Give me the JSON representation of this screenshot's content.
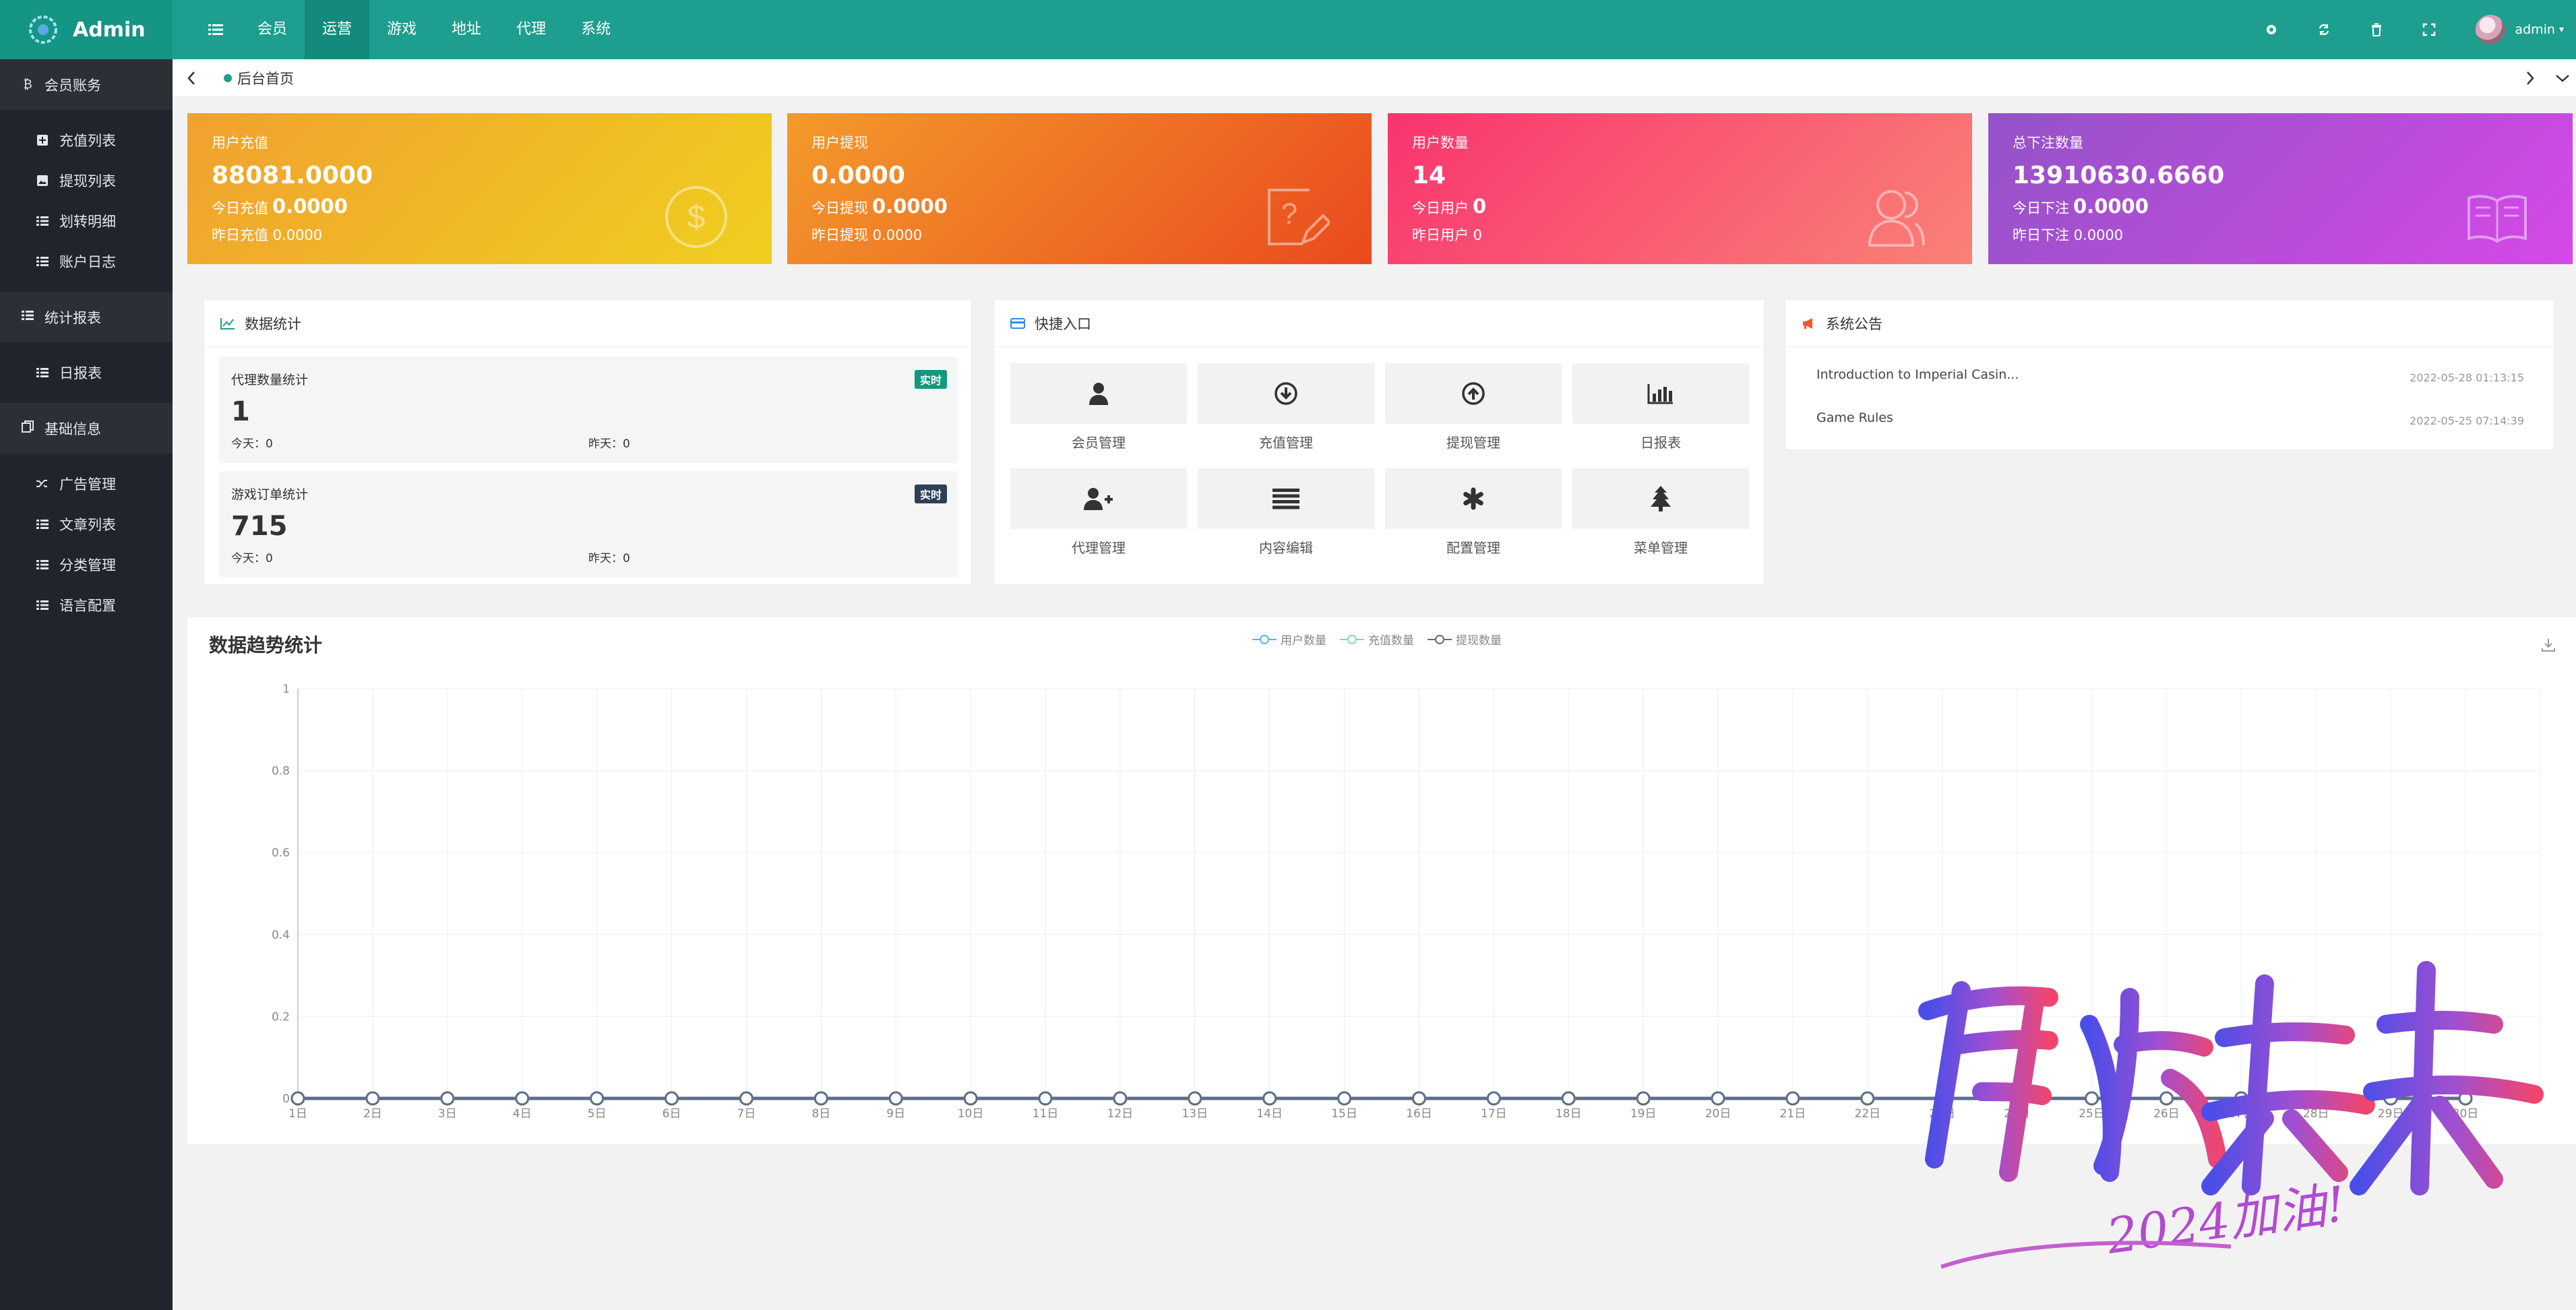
{
  "app": {
    "title": "Admin"
  },
  "topnav": [
    "会员",
    "运营",
    "游戏",
    "地址",
    "代理",
    "系统"
  ],
  "topnav_active": 1,
  "user": {
    "name": "admin"
  },
  "sidebar": {
    "groups": [
      {
        "label": "会员账务",
        "items": [
          "充值列表",
          "提现列表",
          "划转明细",
          "账户日志"
        ]
      },
      {
        "label": "统计报表",
        "items": [
          "日报表"
        ]
      },
      {
        "label": "基础信息",
        "items": [
          "广告管理",
          "文章列表",
          "分类管理",
          "语言配置"
        ]
      }
    ]
  },
  "breadcrumb": "后台首页",
  "stats": [
    {
      "title": "用户充值",
      "value": "88081.0000",
      "today_label": "今日充值",
      "today_value": "0.0000",
      "yesterday": "昨日充值 0.0000",
      "icon": "dollar-circle-icon"
    },
    {
      "title": "用户提现",
      "value": "0.0000",
      "today_label": "今日提现",
      "today_value": "0.0000",
      "yesterday": "昨日提现 0.0000",
      "icon": "question-edit-icon"
    },
    {
      "title": "用户数量",
      "value": "14",
      "today_label": "今日用户",
      "today_value": "0",
      "yesterday": "昨日用户 0",
      "icon": "users-icon"
    },
    {
      "title": "总下注数量",
      "value": "13910630.6660",
      "today_label": "今日下注",
      "today_value": "0.0000",
      "yesterday": "昨日下注 0.0000",
      "icon": "book-icon"
    }
  ],
  "data_stats": {
    "title": "数据统计",
    "cards": [
      {
        "title": "代理数量统计",
        "badge": "实时",
        "badge_color": "#15977f",
        "value": "1",
        "today": "今天：0",
        "yesterday": "昨天：0"
      },
      {
        "title": "游戏订单统计",
        "badge": "实时",
        "badge_color": "#2f4056",
        "value": "715",
        "today": "今天：0",
        "yesterday": "昨天：0"
      }
    ]
  },
  "quick": {
    "title": "快捷入口",
    "items": [
      {
        "label": "会员管理",
        "icon": "user-icon"
      },
      {
        "label": "充值管理",
        "icon": "arrow-down-circle-icon"
      },
      {
        "label": "提现管理",
        "icon": "arrow-up-circle-icon"
      },
      {
        "label": "日报表",
        "icon": "bar-chart-icon"
      },
      {
        "label": "代理管理",
        "icon": "user-plus-icon"
      },
      {
        "label": "内容编辑",
        "icon": "list-icon"
      },
      {
        "label": "配置管理",
        "icon": "asterisk-icon"
      },
      {
        "label": "菜单管理",
        "icon": "tree-icon"
      }
    ]
  },
  "notice": {
    "title": "系统公告",
    "items": [
      {
        "title": "Introduction to Imperial Casin...",
        "date": "2022-05-28 01:13:15"
      },
      {
        "title": "Game Rules",
        "date": "2022-05-25 07:14:39"
      }
    ]
  },
  "watermark": {
    "text": "启航未来",
    "sub": "2024加油!"
  },
  "colors": {
    "primary": "#1e9e8e",
    "sidebar": "#20242c"
  },
  "chart_data": {
    "type": "line",
    "title": "数据趋势统计",
    "categories": [
      "1日",
      "2日",
      "3日",
      "4日",
      "5日",
      "6日",
      "7日",
      "8日",
      "9日",
      "10日",
      "11日",
      "12日",
      "13日",
      "14日",
      "15日",
      "16日",
      "17日",
      "18日",
      "19日",
      "20日",
      "21日",
      "22日",
      "23日",
      "24日",
      "25日",
      "26日",
      "27日",
      "28日",
      "29日",
      "30日"
    ],
    "series": [
      {
        "name": "用户数量",
        "color": "#5ab1ef",
        "values": [
          0,
          0,
          0,
          0,
          0,
          0,
          0,
          0,
          0,
          0,
          0,
          0,
          0,
          0,
          0,
          0,
          0,
          0,
          0,
          0,
          0,
          0,
          0,
          0,
          0,
          0,
          0,
          0,
          0,
          0
        ]
      },
      {
        "name": "充值数量",
        "color": "#88d4c7",
        "values": [
          0,
          0,
          0,
          0,
          0,
          0,
          0,
          0,
          0,
          0,
          0,
          0,
          0,
          0,
          0,
          0,
          0,
          0,
          0,
          0,
          0,
          0,
          0,
          0,
          0,
          0,
          0,
          0,
          0,
          0
        ]
      },
      {
        "name": "提现数量",
        "color": "#5b6e87",
        "values": [
          0,
          0,
          0,
          0,
          0,
          0,
          0,
          0,
          0,
          0,
          0,
          0,
          0,
          0,
          0,
          0,
          0,
          0,
          0,
          0,
          0,
          0,
          0,
          0,
          0,
          0,
          0,
          0,
          0,
          0
        ]
      }
    ],
    "yticks": [
      "0",
      "0.2",
      "0.4",
      "0.6",
      "0.8",
      "1"
    ],
    "ylim": [
      0,
      1
    ],
    "grid": true,
    "legend": "top-center"
  }
}
